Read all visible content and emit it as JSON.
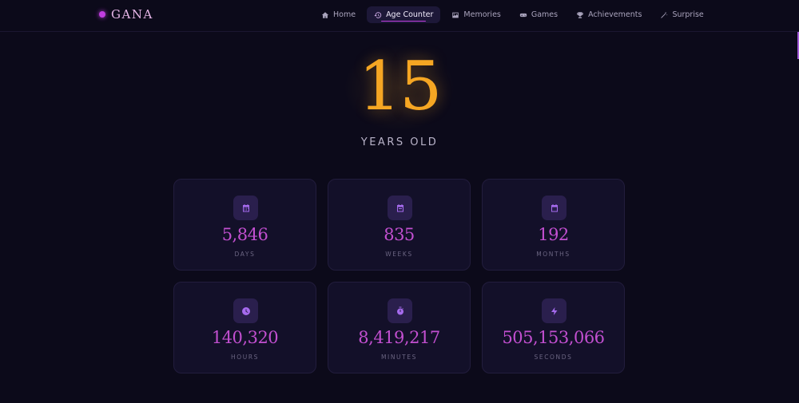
{
  "app": {
    "logo_text": "GANA"
  },
  "nav": {
    "items": [
      {
        "label": "Home",
        "icon": "home-icon"
      },
      {
        "label": "Age Counter",
        "icon": "history-icon",
        "active": true
      },
      {
        "label": "Memories",
        "icon": "image-icon"
      },
      {
        "label": "Games",
        "icon": "gamepad-icon"
      },
      {
        "label": "Achievements",
        "icon": "trophy-icon"
      },
      {
        "label": "Surprise",
        "icon": "magic-wand-icon"
      }
    ]
  },
  "hero": {
    "age": "15",
    "label": "YEARS OLD"
  },
  "stats": [
    {
      "value": "5,846",
      "unit": "DAYS",
      "icon": "calendar-icon"
    },
    {
      "value": "835",
      "unit": "WEEKS",
      "icon": "calendar-icon"
    },
    {
      "value": "192",
      "unit": "MONTHS",
      "icon": "calendar-icon"
    },
    {
      "value": "140,320",
      "unit": "HOURS",
      "icon": "clock-icon"
    },
    {
      "value": "8,419,217",
      "unit": "MINUTES",
      "icon": "stopwatch-icon"
    },
    {
      "value": "505,153,066",
      "unit": "SECONDS",
      "icon": "bolt-icon"
    }
  ],
  "colors": {
    "background": "#0c0a1a",
    "accent": "#c13ee0",
    "age_gold": "#f5a623",
    "stat_value": "#c24fd0",
    "card": "#131029"
  }
}
